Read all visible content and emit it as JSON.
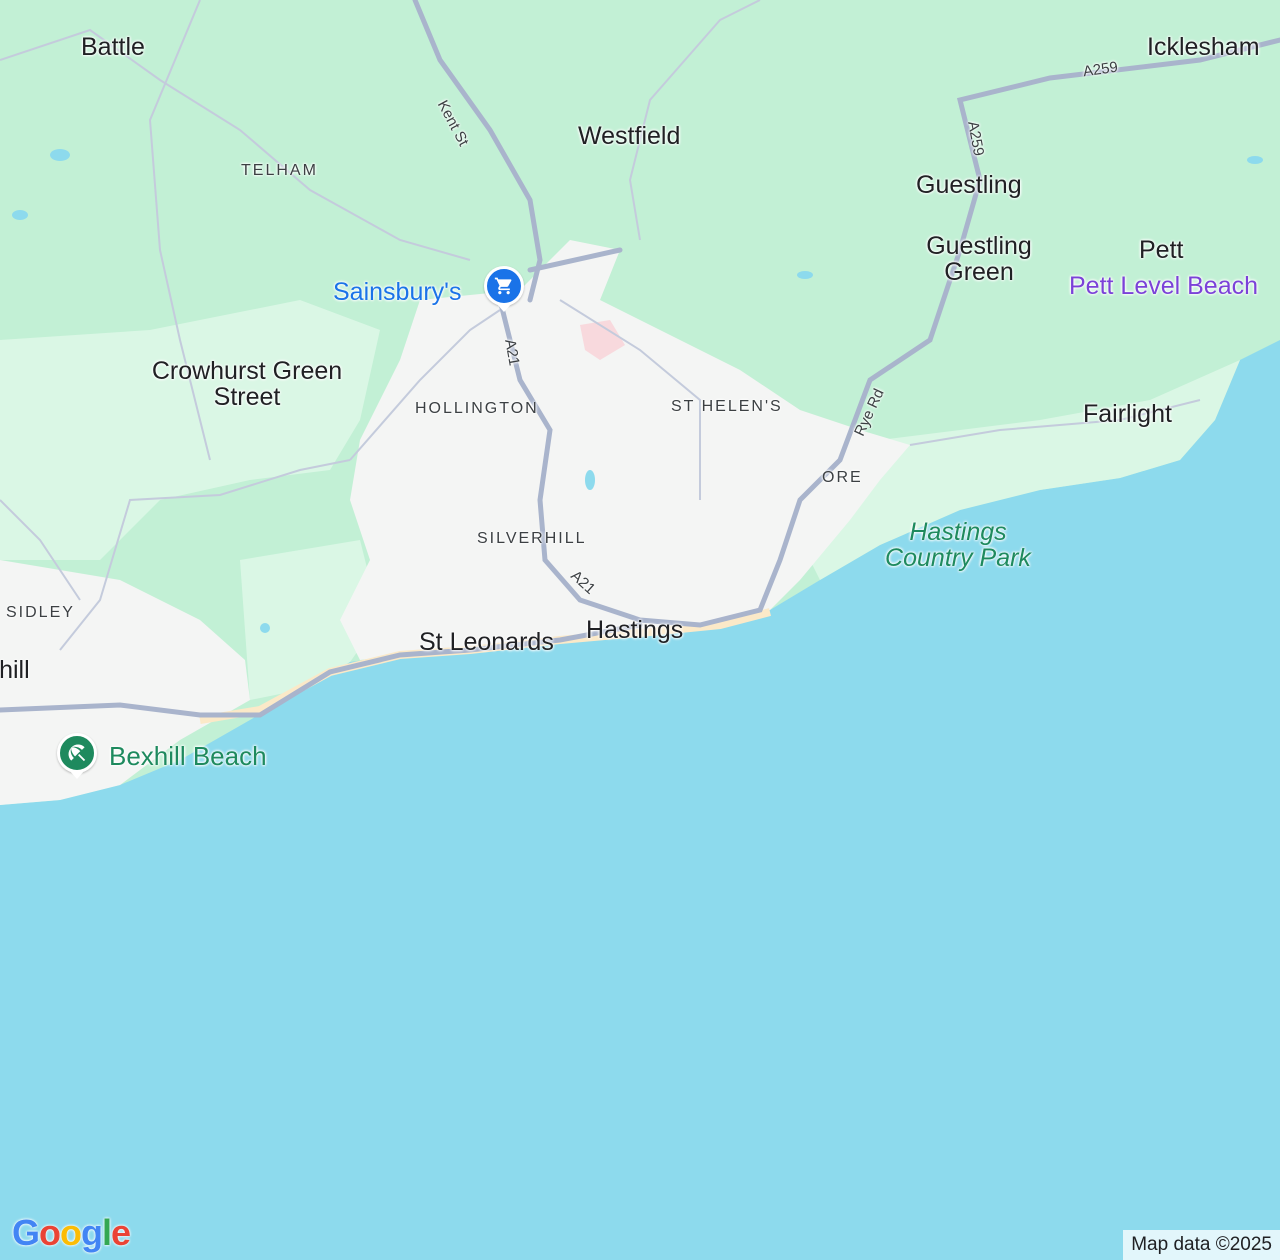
{
  "colors": {
    "sea": "#8ddaed",
    "woodland": "#c2f0d5",
    "grassland": "#daf7e5",
    "urban": "#f4f5f4",
    "road": "#a9b4cc",
    "beach": "#fbe9c8",
    "water_blue": "#1a73e8",
    "park_green": "#1e8a5e",
    "beach_purple": "#7b42d8"
  },
  "places": {
    "battle": "Battle",
    "icklesham": "Icklesham",
    "westfield": "Westfield",
    "telham": "TELHAM",
    "guestling": "Guestling",
    "guestling_green": "Guestling Green",
    "pett": "Pett",
    "crowhurst_green_street": "Crowhurst Green Street",
    "hollington": "HOLLINGTON",
    "st_helens": "ST HELEN'S",
    "fairlight": "Fairlight",
    "ore": "ORE",
    "silverhill": "SILVERHILL",
    "sidley": "SIDLEY",
    "bexhill": "Bexhill",
    "st_leonards": "St Leonards",
    "hastings": "Hastings"
  },
  "roads": {
    "kent_st": "Kent St",
    "a21_north": "A21",
    "a21_south": "A21",
    "a259_east": "A259",
    "a259_north": "A259",
    "rye_rd": "Rye Rd"
  },
  "pois": {
    "sainsburys": {
      "label": "Sainsbury's",
      "icon": "shopping-cart-icon"
    },
    "bexhill_beach": {
      "label": "Bexhill Beach",
      "icon": "beach-umbrella-icon"
    },
    "pett_level_beach": {
      "label": "Pett Level Beach"
    },
    "hastings_country_park": {
      "label": "Hastings Country Park"
    }
  },
  "attribution": "Map data ©2025",
  "logo": "Google"
}
